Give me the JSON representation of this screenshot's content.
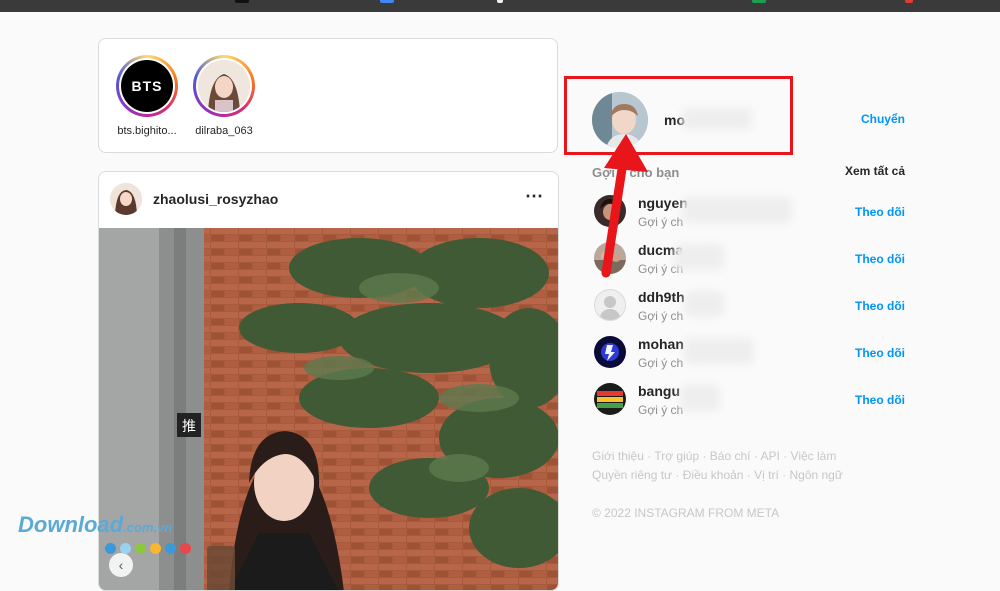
{
  "browser": {
    "topbar": "browser-tab-strip"
  },
  "stories": [
    {
      "name": "bts.bighito...",
      "avatar_text": "BTS"
    },
    {
      "name": "dilraba_063",
      "avatar_text": ""
    }
  ],
  "post": {
    "username": "zhaolusi_rosyzhao",
    "more_icon": "⋯",
    "prev_icon": "‹",
    "sign_text": "推"
  },
  "sidebar": {
    "profile_name": "mo",
    "switch_label": "Chuyển",
    "suggestions_title": "Gợi ý cho bạn",
    "see_all": "Xem tất cả",
    "suggestions": [
      {
        "name": "nguyen",
        "sub": "Gợi ý ch",
        "follow": "Theo dõi"
      },
      {
        "name": "ducma",
        "sub": "Gợi ý ch",
        "follow": "Theo dõi"
      },
      {
        "name": "ddh9th",
        "sub": "Gợi ý ch",
        "follow": "Theo dõi"
      },
      {
        "name": "mohan",
        "sub": "Gợi ý ch",
        "follow": "Theo dõi"
      },
      {
        "name": "bangu",
        "sub": "Gợi ý ch",
        "follow": "Theo dõi"
      }
    ],
    "footer_line1": [
      "Giới thiệu",
      "Trợ giúp",
      "Báo chí",
      "API",
      "Việc làm"
    ],
    "footer_line2": [
      "Quyền riêng tư",
      "Điều khoản",
      "Vị trí",
      "Ngôn ngữ"
    ],
    "footer_sep": " · ",
    "copyright": "© 2022 INSTAGRAM FROM META"
  },
  "watermark": {
    "main": "Download",
    "suffix": ".com.vn"
  },
  "colors": {
    "link": "#0095f6",
    "highlight": "#e8151b",
    "watermark": "#5aa9d6"
  }
}
